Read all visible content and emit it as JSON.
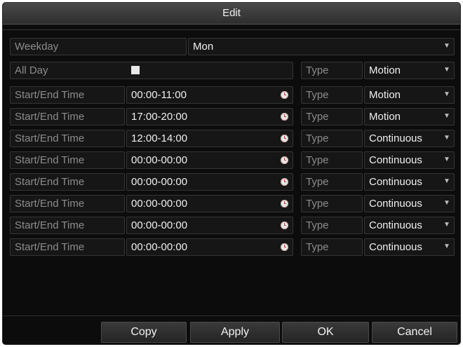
{
  "dialog": {
    "title": "Edit"
  },
  "weekday": {
    "label": "Weekday",
    "value": "Mon"
  },
  "allday": {
    "label": "All Day",
    "checked": true,
    "type_label": "Type",
    "type_value": "Motion"
  },
  "rows": [
    {
      "label": "Start/End Time",
      "time": "00:00-11:00",
      "type_label": "Type",
      "type_value": "Motion"
    },
    {
      "label": "Start/End Time",
      "time": "17:00-20:00",
      "type_label": "Type",
      "type_value": "Motion"
    },
    {
      "label": "Start/End Time",
      "time": "12:00-14:00",
      "type_label": "Type",
      "type_value": "Continuous"
    },
    {
      "label": "Start/End Time",
      "time": "00:00-00:00",
      "type_label": "Type",
      "type_value": "Continuous"
    },
    {
      "label": "Start/End Time",
      "time": "00:00-00:00",
      "type_label": "Type",
      "type_value": "Continuous"
    },
    {
      "label": "Start/End Time",
      "time": "00:00-00:00",
      "type_label": "Type",
      "type_value": "Continuous"
    },
    {
      "label": "Start/End Time",
      "time": "00:00-00:00",
      "type_label": "Type",
      "type_value": "Continuous"
    },
    {
      "label": "Start/End Time",
      "time": "00:00-00:00",
      "type_label": "Type",
      "type_value": "Continuous"
    }
  ],
  "buttons": {
    "copy": "Copy",
    "apply": "Apply",
    "ok": "OK",
    "cancel": "Cancel"
  },
  "icons": {
    "clock": "clock-icon",
    "dropdown": "chevron-down-icon",
    "checkbox": "checkbox-icon"
  }
}
